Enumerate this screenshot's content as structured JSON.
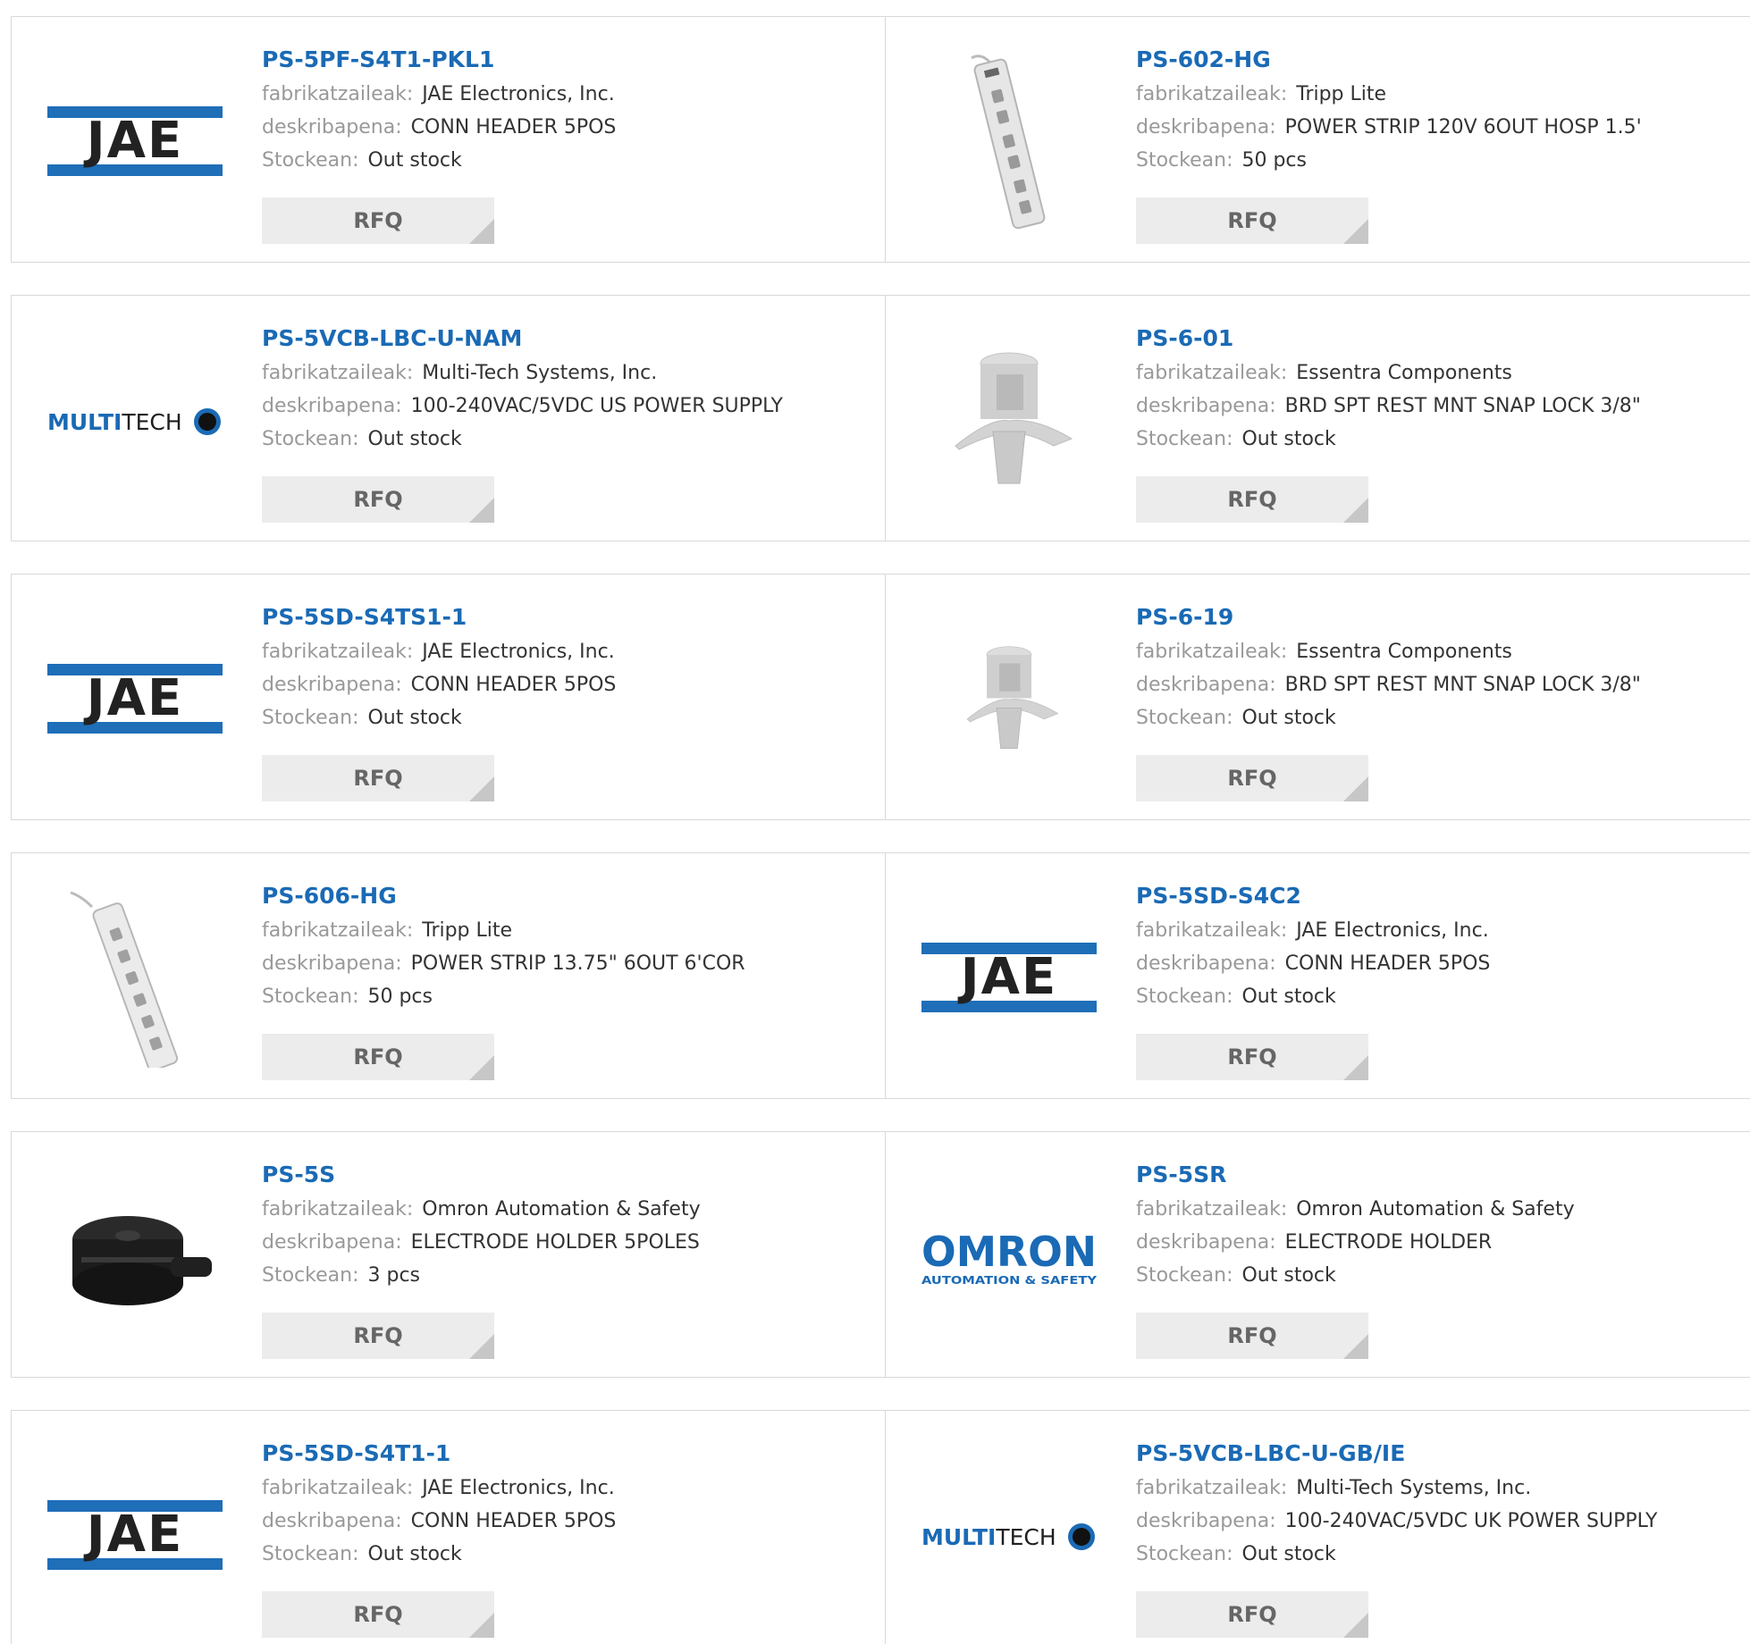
{
  "labels": {
    "manufacturer": "fabrikatzaileak:",
    "description": "deskribapena:",
    "stock": "Stockean:",
    "rfq": "RFQ"
  },
  "colors": {
    "part_link": "#1a6ab5",
    "jae_blue": "#1f6eb8",
    "rfq_bg": "#ececec"
  },
  "logos": {
    "jae": "JAE",
    "multitech_bold": "MULTI",
    "multitech_light": "TECH",
    "omron": "OMRON",
    "omron_sub": "AUTOMATION & SAFETY"
  },
  "products": [
    {
      "part": "PS-5PF-S4T1-PKL1",
      "manufacturer": "JAE Electronics, Inc.",
      "description": "CONN HEADER 5POS",
      "stock": "Out stock",
      "image": "jae-logo"
    },
    {
      "part": "PS-602-HG",
      "manufacturer": "Tripp Lite",
      "description": "POWER STRIP 120V 6OUT HOSP 1.5'",
      "stock": "50 pcs",
      "image": "power-strip-vertical"
    },
    {
      "part": "PS-5VCB-LBC-U-NAM",
      "manufacturer": "Multi-Tech Systems, Inc.",
      "description": "100-240VAC/5VDC US POWER SUPPLY",
      "stock": "Out stock",
      "image": "multitech-logo"
    },
    {
      "part": "PS-6-01",
      "manufacturer": "Essentra Components",
      "description": "BRD SPT REST MNT SNAP LOCK 3/8\"",
      "stock": "Out stock",
      "image": "snap-lock-support"
    },
    {
      "part": "PS-5SD-S4TS1-1",
      "manufacturer": "JAE Electronics, Inc.",
      "description": "CONN HEADER 5POS",
      "stock": "Out stock",
      "image": "jae-logo"
    },
    {
      "part": "PS-6-19",
      "manufacturer": "Essentra Components",
      "description": "BRD SPT REST MNT SNAP LOCK 3/8\"",
      "stock": "Out stock",
      "image": "snap-lock-support-small"
    },
    {
      "part": "PS-606-HG",
      "manufacturer": "Tripp Lite",
      "description": "POWER STRIP 13.75\" 6OUT 6'COR",
      "stock": "50 pcs",
      "image": "power-strip-diagonal"
    },
    {
      "part": "PS-5SD-S4C2",
      "manufacturer": "JAE Electronics, Inc.",
      "description": "CONN HEADER 5POS",
      "stock": "Out stock",
      "image": "jae-logo"
    },
    {
      "part": "PS-5S",
      "manufacturer": "Omron Automation & Safety",
      "description": "ELECTRODE HOLDER 5POLES",
      "stock": "3 pcs",
      "image": "electrode-holder"
    },
    {
      "part": "PS-5SR",
      "manufacturer": "Omron Automation & Safety",
      "description": "ELECTRODE HOLDER",
      "stock": "Out stock",
      "image": "omron-logo"
    },
    {
      "part": "PS-5SD-S4T1-1",
      "manufacturer": "JAE Electronics, Inc.",
      "description": "CONN HEADER 5POS",
      "stock": "Out stock",
      "image": "jae-logo"
    },
    {
      "part": "PS-5VCB-LBC-U-GB/IE",
      "manufacturer": "Multi-Tech Systems, Inc.",
      "description": "100-240VAC/5VDC UK POWER SUPPLY",
      "stock": "Out stock",
      "image": "multitech-logo"
    }
  ]
}
